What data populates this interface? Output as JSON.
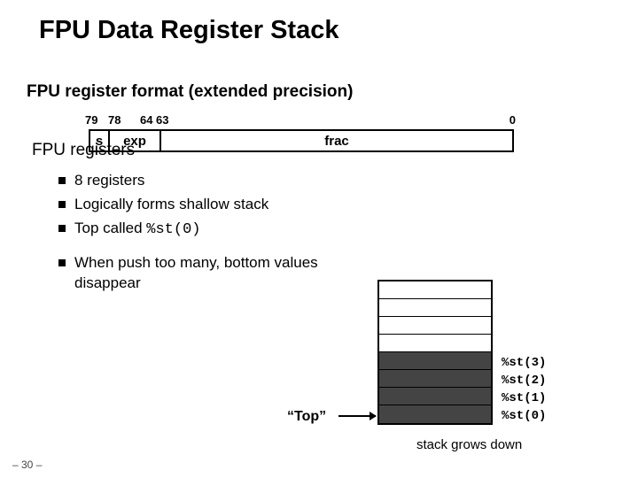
{
  "title": "FPU Data Register Stack",
  "subtitle": "FPU register format (extended precision)",
  "format": {
    "bits": {
      "b79": "79",
      "b78": "78",
      "b64": "64",
      "b63": "63",
      "b0": "0"
    },
    "fields": {
      "s": "s",
      "exp": "exp",
      "frac": "frac"
    }
  },
  "section2": "FPU registers",
  "bullets": {
    "b1": "8 registers",
    "b2": "Logically forms shallow stack",
    "b3_pre": "Top called ",
    "b3_code": "%st(0)",
    "b4": "When push too many, bottom values disappear"
  },
  "stack": {
    "labels": {
      "l3": "%st(3)",
      "l2": "%st(2)",
      "l1": "%st(1)",
      "l0": "%st(0)"
    },
    "top": "“Top”",
    "grows": "stack grows down"
  },
  "footer": "– 30 –"
}
